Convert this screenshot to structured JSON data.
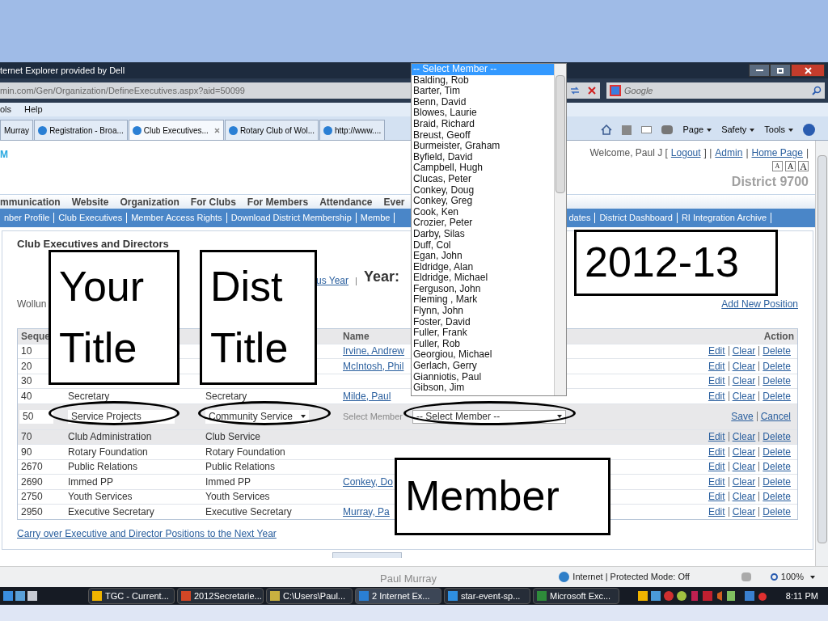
{
  "window": {
    "title": "ternet Explorer provided by Dell"
  },
  "address_bar": {
    "url": "min.com/Gen/Organization/DefineExecutives.aspx?aid=50099",
    "search_placeholder": "Google"
  },
  "menu": [
    "ols",
    "Help"
  ],
  "tabs": [
    {
      "label": "Murray",
      "selected": false
    },
    {
      "label": "Registration - Broa...",
      "selected": false
    },
    {
      "label": "Club Executives...",
      "selected": true
    },
    {
      "label": "Rotary Club of Wol...",
      "selected": false
    },
    {
      "label": "http://www....",
      "selected": false
    }
  ],
  "command_bar": [
    "Page",
    "Safety",
    "Tools"
  ],
  "header": {
    "logo": "M",
    "user_links": [
      {
        "kind": "text",
        "text": "Welcome, Paul J ["
      },
      {
        "kind": "link",
        "text": "Logout"
      },
      {
        "kind": "text",
        "text": "] |"
      },
      {
        "kind": "link",
        "text": "Admin"
      },
      {
        "kind": "text",
        "text": "|"
      },
      {
        "kind": "link",
        "text": "Home Page"
      },
      {
        "kind": "text",
        "text": "|"
      }
    ],
    "font_sizes": [
      "A",
      "A",
      "A"
    ],
    "district": "District 9700"
  },
  "main_nav": [
    "mmunication",
    "Website",
    "Organization",
    "For Clubs",
    "For Members",
    "Attendance",
    "Ever"
  ],
  "sub_nav": [
    "nber Profile",
    "Club Executives",
    "Member Access Rights",
    "Download District Membership",
    "Membe",
    "dates",
    "District Dashboard",
    "RI Integration Archive"
  ],
  "panel": {
    "title": "Club Executives and Directors",
    "prev_year": "us Year",
    "separator": "|",
    "year_label": "Year:",
    "club": "Wollun",
    "add_link": "Add New Position",
    "columns": [
      "Seque",
      "Name",
      "Action"
    ],
    "rows": [
      {
        "kind": "view",
        "highlighted": false,
        "seq": "10",
        "title": "",
        "dist": "",
        "name": "Irvine, Andrew",
        "actions": [
          "Edit",
          "Clear",
          "Delete"
        ]
      },
      {
        "kind": "view",
        "highlighted": false,
        "seq": "20",
        "title": "",
        "dist": "",
        "name": "McIntosh, Phil",
        "actions": [
          "Edit",
          "Clear",
          "Delete"
        ]
      },
      {
        "kind": "view",
        "highlighted": false,
        "seq": "30",
        "title": "",
        "dist": "",
        "name": "",
        "actions": [
          "Edit",
          "Clear",
          "Delete"
        ]
      },
      {
        "kind": "view",
        "highlighted": false,
        "seq": "40",
        "title": "Secretary",
        "dist": "Secretary",
        "name": "Milde, Paul",
        "actions": [
          "Edit",
          "Clear",
          "Delete"
        ]
      },
      {
        "kind": "edit",
        "highlighted": true,
        "seq": "50",
        "title": "Service Projects",
        "dist": "Community Service",
        "name_label": "Select Member",
        "name": "-- Select Member --",
        "actions": [
          "Save",
          "Cancel"
        ]
      },
      {
        "kind": "view",
        "highlighted": true,
        "seq": "70",
        "title": "Club Administration",
        "dist": "Club Service",
        "name": "",
        "actions": [
          "Edit",
          "Clear",
          "Delete"
        ]
      },
      {
        "kind": "view",
        "highlighted": false,
        "seq": "90",
        "title": "Rotary Foundation",
        "dist": "Rotary Foundation",
        "name": "",
        "actions": [
          "Edit",
          "Clear",
          "Delete"
        ]
      },
      {
        "kind": "view",
        "highlighted": false,
        "seq": "2670",
        "title": "Public Relations",
        "dist": "Public Relations",
        "name": "",
        "actions": [
          "Edit",
          "Clear",
          "Delete"
        ]
      },
      {
        "kind": "view",
        "highlighted": false,
        "seq": "2690",
        "title": "Immed PP",
        "dist": "Immed PP",
        "name": "Conkey, Do",
        "actions": [
          "Edit",
          "Clear",
          "Delete"
        ]
      },
      {
        "kind": "view",
        "highlighted": false,
        "seq": "2750",
        "title": "Youth Services",
        "dist": "Youth Services",
        "name": "",
        "actions": [
          "Edit",
          "Clear",
          "Delete"
        ]
      },
      {
        "kind": "view",
        "highlighted": false,
        "seq": "2950",
        "title": "Executive Secretary",
        "dist": "Executive Secretary",
        "name": "Murray, Pa",
        "actions": [
          "Edit",
          "Clear",
          "Delete"
        ]
      }
    ],
    "carry_link": "Carry over Executive and Director Positions to the Next Year"
  },
  "dropdown": [
    {
      "label": "-- Select Member --",
      "selected": true
    },
    {
      "label": "Balding, Rob",
      "selected": false
    },
    {
      "label": "Barter, Tim",
      "selected": false
    },
    {
      "label": "Benn, David",
      "selected": false
    },
    {
      "label": "Blowes, Laurie",
      "selected": false
    },
    {
      "label": "Braid, Richard",
      "selected": false
    },
    {
      "label": "Breust, Geoff",
      "selected": false
    },
    {
      "label": "Burmeister, Graham",
      "selected": false
    },
    {
      "label": "Byfield, David",
      "selected": false
    },
    {
      "label": "Campbell, Hugh",
      "selected": false
    },
    {
      "label": "Clucas, Peter",
      "selected": false
    },
    {
      "label": "Conkey, Doug",
      "selected": false
    },
    {
      "label": "Conkey, Greg",
      "selected": false
    },
    {
      "label": "Cook, Ken",
      "selected": false
    },
    {
      "label": "Crozier, Peter",
      "selected": false
    },
    {
      "label": "Darby, Silas",
      "selected": false
    },
    {
      "label": "Duff, Col",
      "selected": false
    },
    {
      "label": "Egan, John",
      "selected": false
    },
    {
      "label": "Eldridge, Alan",
      "selected": false
    },
    {
      "label": "Eldridge, Michael",
      "selected": false
    },
    {
      "label": "Ferguson, John",
      "selected": false
    },
    {
      "label": "Fleming , Mark",
      "selected": false
    },
    {
      "label": "Flynn, John",
      "selected": false
    },
    {
      "label": "Foster, David",
      "selected": false
    },
    {
      "label": "Fuller, Frank",
      "selected": false
    },
    {
      "label": "Fuller, Rob",
      "selected": false
    },
    {
      "label": "Georgiou, Michael",
      "selected": false
    },
    {
      "label": "Gerlach, Gerry",
      "selected": false
    },
    {
      "label": "Gianniotis, Paul",
      "selected": false
    },
    {
      "label": "Gibson, Jim",
      "selected": false
    }
  ],
  "annotations": [
    {
      "kind": "box",
      "text": "Your Title"
    },
    {
      "kind": "box",
      "text": "Dist Title"
    },
    {
      "kind": "box",
      "text": "2012-13"
    },
    {
      "kind": "ellipse"
    },
    {
      "kind": "ellipse"
    },
    {
      "kind": "ellipse"
    },
    {
      "kind": "box",
      "text": "Member"
    }
  ],
  "status_bar": {
    "zone": "Internet | Protected Mode: Off",
    "zoom": "100%"
  },
  "taskbar": {
    "items": [
      {
        "label": "TGC - Current...",
        "color": "#f0b400",
        "active": false
      },
      {
        "label": "2012Secretarie...",
        "color": "#d24726",
        "active": false
      },
      {
        "label": "C:\\Users\\Paul...",
        "color": "#c8b040",
        "active": false
      },
      {
        "label": "2 Internet Ex...",
        "color": "#2a7fd4",
        "active": true
      },
      {
        "label": "star-event-sp...",
        "color": "#2f8fe0",
        "active": false
      },
      {
        "label": "Microsoft Exc...",
        "color": "#2e8b3a",
        "active": false
      }
    ],
    "clock": "8:11 PM"
  },
  "slide": {
    "footer": "Paul Murray"
  }
}
